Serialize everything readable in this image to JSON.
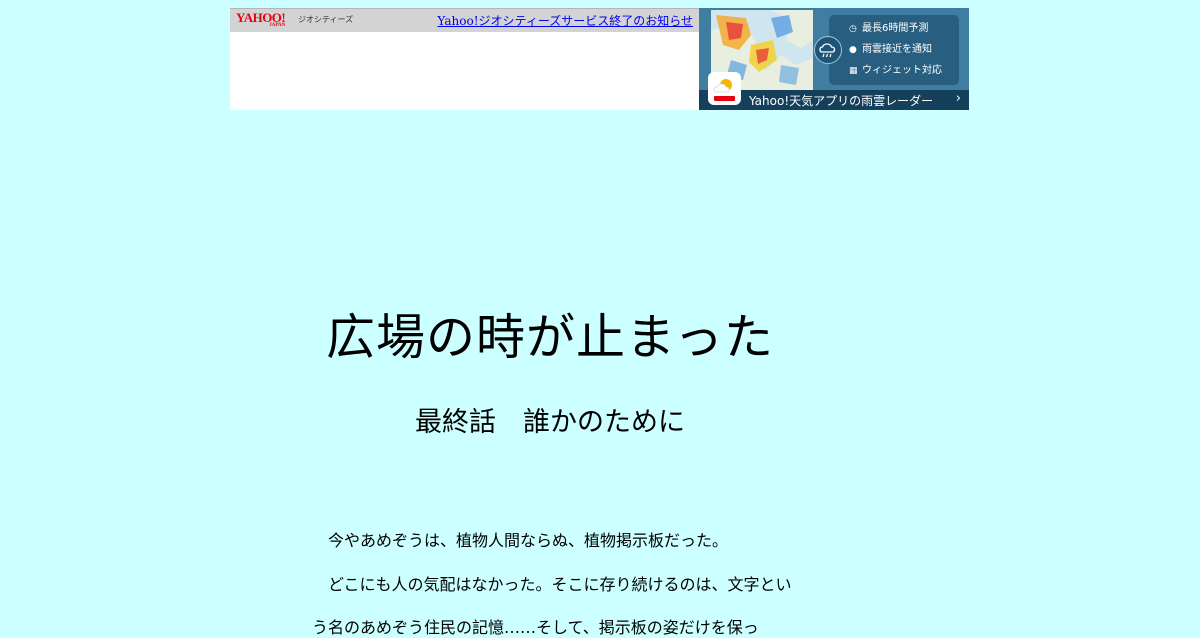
{
  "banner": {
    "yahoo_logo": "YAHOO!",
    "yahoo_logo_sub": "JAPAN",
    "geocities_name": "ジオシティーズ",
    "closing_notice_link": "Yahoo!ジオシティーズサービス終了のお知らせ",
    "weather_ad": {
      "features": [
        {
          "icon": "clock-icon",
          "label": "最長6時間予測"
        },
        {
          "icon": "location-pin-icon",
          "label": "雨雲接近を通知"
        },
        {
          "icon": "widget-grid-icon",
          "label": "ウィジェット対応"
        }
      ],
      "footer_text": "Yahoo!天気アプリの雨雲レーダー",
      "chevron": "›",
      "colors": {
        "panel": "#285f80",
        "footer": "#14405c",
        "background": "#3f7ea0"
      }
    }
  },
  "story": {
    "title": "広場の時が止まった",
    "subtitle": "最終話　誰かのために",
    "paragraphs": [
      "　今やあめぞうは、植物人間ならぬ、植物掲示板だった。",
      "　どこにも人の気配はなかった。そこに存り続けるのは、文字とい",
      "う名のあめぞう住民の記憶……そして、掲示板の姿だけを保っ"
    ]
  },
  "colors": {
    "page_background": "#ccffff",
    "link": "#0000ee"
  }
}
